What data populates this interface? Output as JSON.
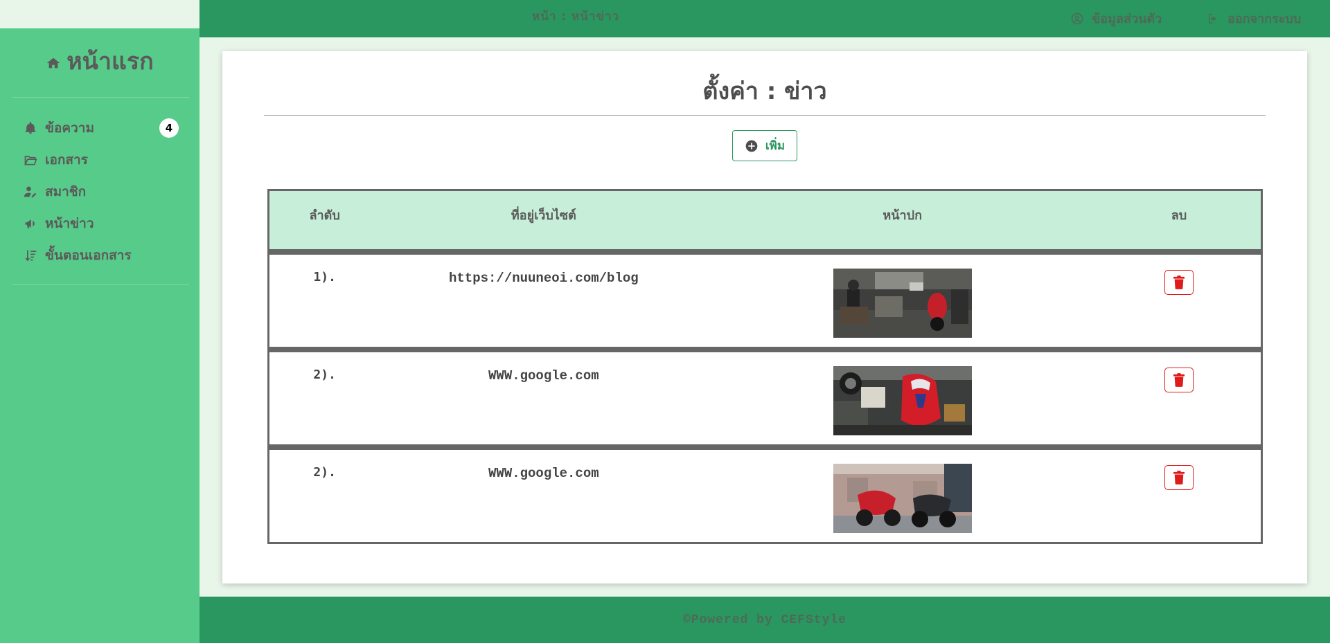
{
  "sidebar": {
    "brand": "หน้าแรก",
    "brand_icon": "home-icon",
    "items": [
      {
        "label": "ข้อความ",
        "icon": "bell-icon",
        "badge": "4"
      },
      {
        "label": "เอกสาร",
        "icon": "folder-open-icon"
      },
      {
        "label": "สมาชิก",
        "icon": "user-edit-icon"
      },
      {
        "label": "หน้าข่าว",
        "icon": "megaphone-icon"
      },
      {
        "label": "ขั้นตอนเอกสาร",
        "icon": "sort-amount-icon"
      }
    ]
  },
  "topbar": {
    "breadcrumb": "หน้า  :  หน้าข่าว",
    "profile_label": "ข้อมูลส่วนตัว",
    "logout_label": "ออกจากระบบ"
  },
  "main": {
    "title": "ตั้งค่า : ข่าว",
    "add_label": "เพิ่ม",
    "columns": [
      "ลำดับ",
      "ที่อยู่เว็บไซต์",
      "หน้าปก",
      "ลบ"
    ],
    "rows": [
      {
        "index": "1).",
        "url": "https://nuuneoi.com/blog",
        "image": "motorcycle-garage-image"
      },
      {
        "index": "2).",
        "url": "WWW.google.com",
        "image": "red-motorcycle-image"
      },
      {
        "index": "2).",
        "url": "WWW.google.com",
        "image": "two-motorcycles-image"
      }
    ]
  },
  "footer": {
    "text": "©Powered by CEFStyle"
  },
  "colors": {
    "sidebar": "#57cb89",
    "topbar": "#2a9660",
    "header_row": "#c6eed8",
    "delete": "#e01b1b"
  }
}
